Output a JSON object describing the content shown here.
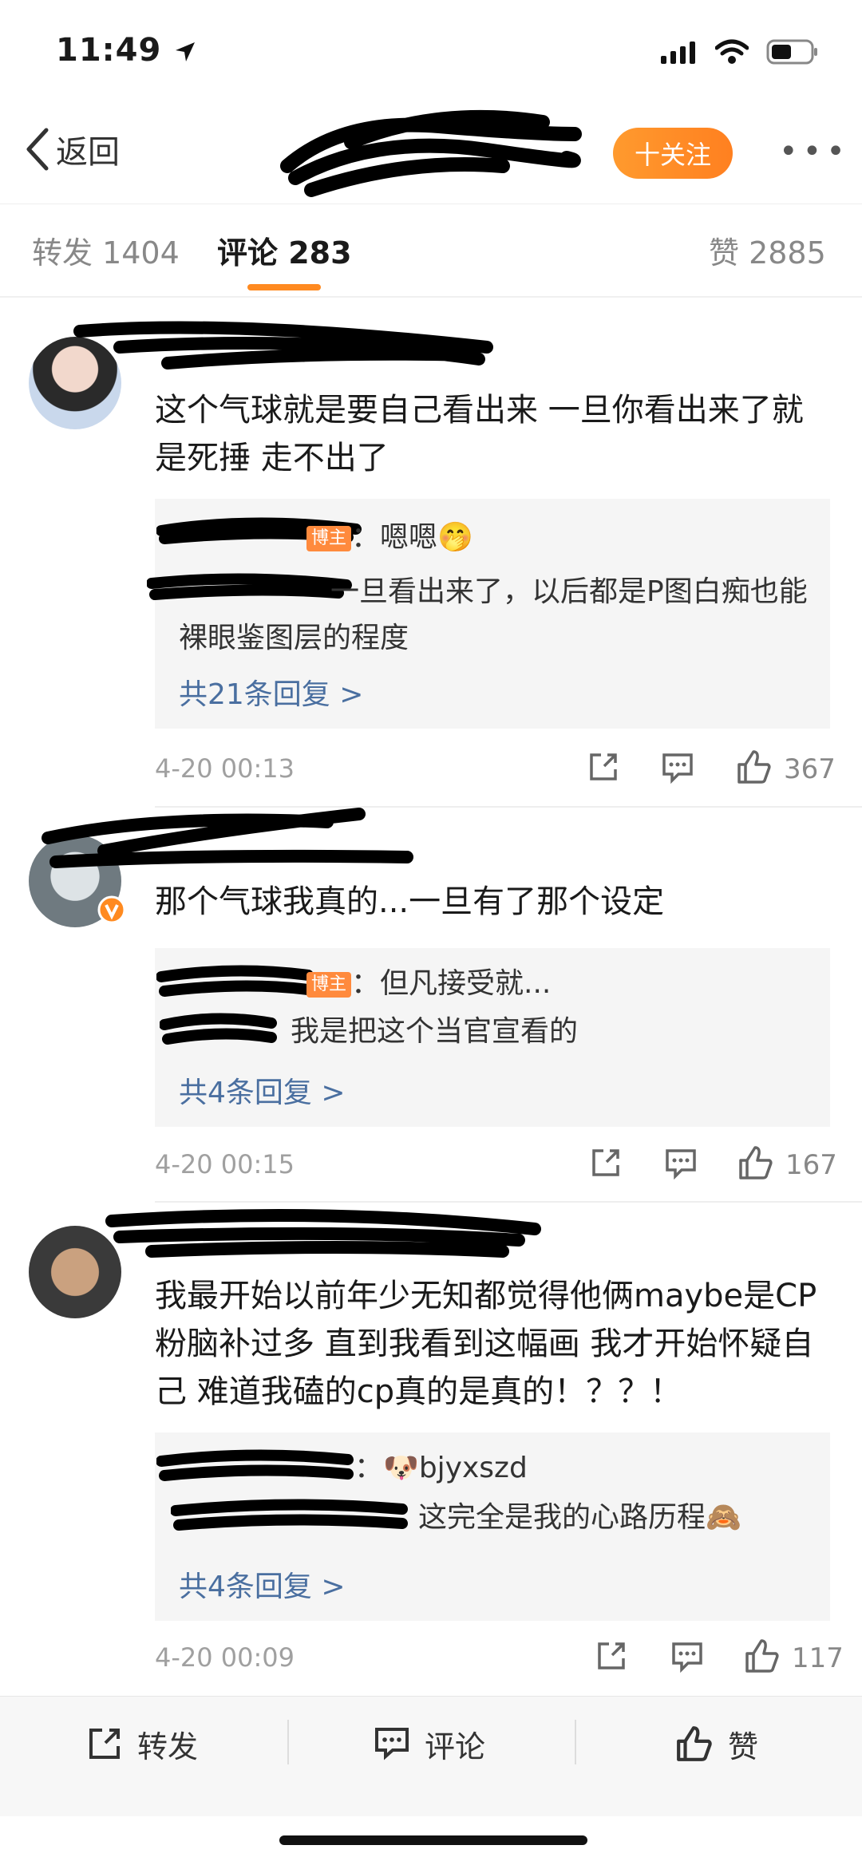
{
  "status_bar": {
    "time": "11:49"
  },
  "nav": {
    "back_label": "返回",
    "follow_label": "十关注",
    "more_label": "•••"
  },
  "tabs": [
    {
      "label": "转发 1404"
    },
    {
      "label": "评论 283"
    },
    {
      "label": "赞 2885"
    }
  ],
  "comments": [
    {
      "text": "这个气球就是要自己看出来 一旦你看出来了就是死捶 走不出了",
      "replies": [
        {
          "prefix": "博主",
          "text": "：嗯嗯🤭"
        },
        {
          "prefix": "",
          "text": "一旦看出来了，以后都是P图白痴也能裸眼鉴图层的程度"
        }
      ],
      "more_replies": "共21条回复 >",
      "time": "4-20 00:13",
      "likes": "367"
    },
    {
      "text": "那个气球我真的...一旦有了那个设定",
      "replies": [
        {
          "prefix": "博主",
          "text": "：但凡接受就..."
        },
        {
          "prefix": "",
          "text": "我是把这个当官宣看的"
        }
      ],
      "more_replies": "共4条回复 >",
      "time": "4-20 00:15",
      "likes": "167"
    },
    {
      "text": "我最开始以前年少无知都觉得他俩maybe是CP粉脑补过多  直到我看到这幅画 我才开始怀疑自己 难道我磕的cp真的是真的！？？！",
      "replies": [
        {
          "prefix": "",
          "text": "：🐶bjyxszd"
        },
        {
          "prefix": "",
          "text": "这完全是我的心路历程🙈"
        }
      ],
      "more_replies": "共4条回复 >",
      "time": "4-20 00:09",
      "likes": "117"
    }
  ],
  "bottom_bar": {
    "repost_label": "转发",
    "comment_label": "评论",
    "like_label": "赞"
  },
  "colors": {
    "accent": "#ff8a20",
    "link": "#4a6fa0"
  },
  "icons": [
    "location-arrow-icon",
    "signal-icon",
    "wifi-icon",
    "battery-icon",
    "back-chevron-icon",
    "share-icon",
    "comment-icon",
    "like-icon"
  ]
}
